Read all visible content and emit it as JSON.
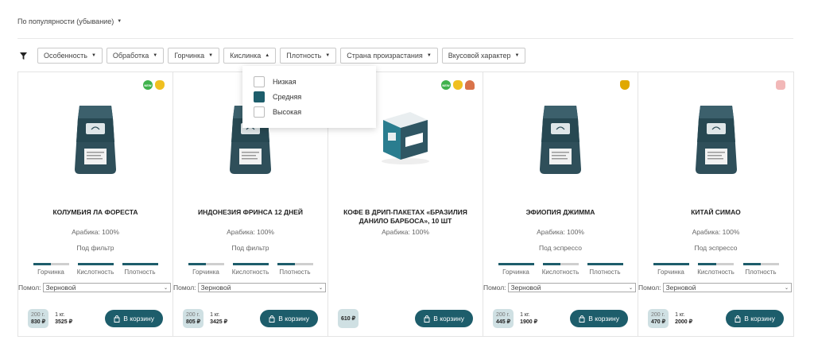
{
  "sort": {
    "label": "По популярности (убывание)"
  },
  "filters": [
    {
      "label": "Особенность"
    },
    {
      "label": "Обработка"
    },
    {
      "label": "Горчинка"
    },
    {
      "label": "Кислинка"
    },
    {
      "label": "Плотность"
    },
    {
      "label": "Страна произрастания"
    },
    {
      "label": "Вкусовой характер"
    }
  ],
  "acidity_dropdown": {
    "options": [
      {
        "label": "Низкая",
        "checked": false
      },
      {
        "label": "Средняя",
        "checked": true
      },
      {
        "label": "Высокая",
        "checked": false
      }
    ]
  },
  "colors": {
    "accent": "#1d5d6b",
    "price_bg": "#cfe0e3"
  },
  "bar_labels": {
    "bitterness": "Горчинка",
    "acidity": "Кислотность",
    "density": "Плотность"
  },
  "grind_label": "Помол:",
  "products": [
    {
      "name": "КОЛУМБИЯ ЛА ФОРЕСТА",
      "arabica": "Арабика: 100%",
      "method": "Под фильтр",
      "badges": [
        "new-icon",
        "pineapple-icon"
      ],
      "levels": {
        "bitterness": 0.5,
        "acidity": 1.0,
        "density": 1.0
      },
      "grind": "Зерновой",
      "small_weight": "200 г.",
      "small_price": "830 ₽",
      "big_weight": "1 кг.",
      "big_price": "3525 ₽",
      "button": "В корзину",
      "image": "coffee-bag"
    },
    {
      "name": "ИНДОНЕЗИЯ ФРИНСА 12 ДНЕЙ",
      "arabica": "Арабика: 100%",
      "method": "Под фильтр",
      "badges": [],
      "levels": {
        "bitterness": 0.5,
        "acidity": 1.0,
        "density": 0.5
      },
      "grind": "Зерновой",
      "small_weight": "200 г.",
      "small_price": "805 ₽",
      "big_weight": "1 кг.",
      "big_price": "3425 ₽",
      "button": "В корзину",
      "image": "coffee-bag"
    },
    {
      "name": "КОФЕ В ДРИП-ПАКЕТАХ «БРАЗИЛИЯ ДАНИЛО БАРБОСА», 10 ШТ",
      "arabica": "Арабика: 100%",
      "method": "",
      "badges": [
        "new-icon",
        "pineapple-icon",
        "mushroom-icon"
      ],
      "levels": null,
      "grind": null,
      "single_price": "610 ₽",
      "button": "В корзину",
      "image": "drip-box"
    },
    {
      "name": "ЭФИОПИЯ ДЖИММА",
      "arabica": "Арабика: 100%",
      "method": "Под эспрессо",
      "badges": [
        "trophy-icon"
      ],
      "levels": {
        "bitterness": 1.0,
        "acidity": 0.5,
        "density": 1.0
      },
      "grind": "Зерновой",
      "small_weight": "200 г.",
      "small_price": "445 ₽",
      "big_weight": "1 кг.",
      "big_price": "1900 ₽",
      "button": "В корзину",
      "image": "coffee-bag"
    },
    {
      "name": "КИТАЙ СИМАО",
      "arabica": "Арабика: 100%",
      "method": "Под эспрессо",
      "badges": [
        "thumbs-up-icon"
      ],
      "levels": {
        "bitterness": 1.0,
        "acidity": 0.5,
        "density": 0.5
      },
      "grind": "Зерновой",
      "small_weight": "200 г.",
      "small_price": "470 ₽",
      "big_weight": "1 кг.",
      "big_price": "2000 ₽",
      "button": "В корзину",
      "image": "coffee-bag"
    }
  ]
}
